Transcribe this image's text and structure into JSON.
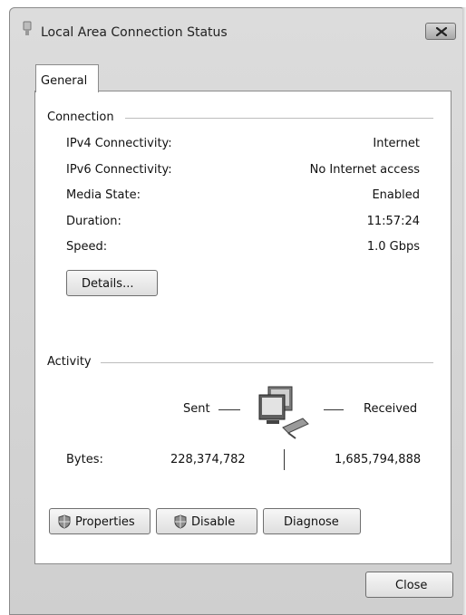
{
  "window": {
    "title": "Local Area Connection Status"
  },
  "tabs": [
    {
      "label": "General"
    }
  ],
  "connection": {
    "group_label": "Connection",
    "rows": [
      {
        "label": "IPv4 Connectivity:",
        "value": "Internet"
      },
      {
        "label": "IPv6 Connectivity:",
        "value": "No Internet access"
      },
      {
        "label": "Media State:",
        "value": "Enabled"
      },
      {
        "label": "Duration:",
        "value": "11:57:24"
      },
      {
        "label": "Speed:",
        "value": "1.0 Gbps"
      }
    ],
    "details_button": "Details..."
  },
  "activity": {
    "group_label": "Activity",
    "sent_label": "Sent",
    "received_label": "Received",
    "bytes_label": "Bytes:",
    "bytes_sent": "228,374,782",
    "bytes_received": "1,685,794,888"
  },
  "buttons": {
    "properties": "Properties",
    "disable": "Disable",
    "diagnose": "Diagnose",
    "close": "Close"
  }
}
